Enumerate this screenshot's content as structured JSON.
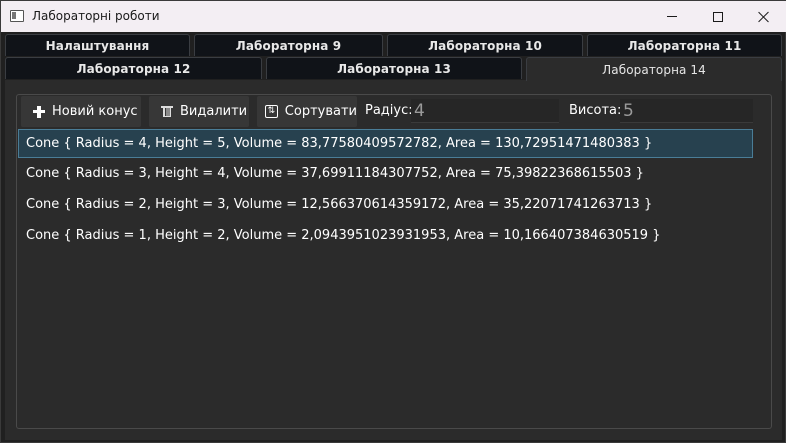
{
  "window": {
    "title": "Лабораторні роботи"
  },
  "tabs": [
    {
      "label": "Налаштування"
    },
    {
      "label": "Лабораторна 9"
    },
    {
      "label": "Лабораторна 10"
    },
    {
      "label": "Лабораторна 11"
    },
    {
      "label": "Лабораторна 12"
    },
    {
      "label": "Лабораторна 13"
    },
    {
      "label": "Лабораторна 14",
      "active": true
    }
  ],
  "toolbar": {
    "new_label": "Новий конус",
    "delete_label": "Видалити",
    "sort_label": "Сортувати",
    "radius_label": "Радіус:",
    "radius_value": "4",
    "height_label": "Висота:",
    "height_value": "5"
  },
  "items": [
    {
      "text": "Cone { Radius = 4, Height = 5, Volume = 83,77580409572782, Area = 130,72951471480383 }",
      "selected": true
    },
    {
      "text": "Cone { Radius = 3, Height = 4, Volume = 37,69911184307752, Area = 75,39822368615503 }"
    },
    {
      "text": "Cone { Radius = 2, Height = 3, Volume = 12,566370614359172, Area = 35,22071741263713 }"
    },
    {
      "text": "Cone { Radius = 1, Height = 2, Volume = 2,0943951023931953, Area = 10,166407384630519 }"
    }
  ],
  "colors": {
    "accent": "#27414f",
    "background": "#202020"
  }
}
